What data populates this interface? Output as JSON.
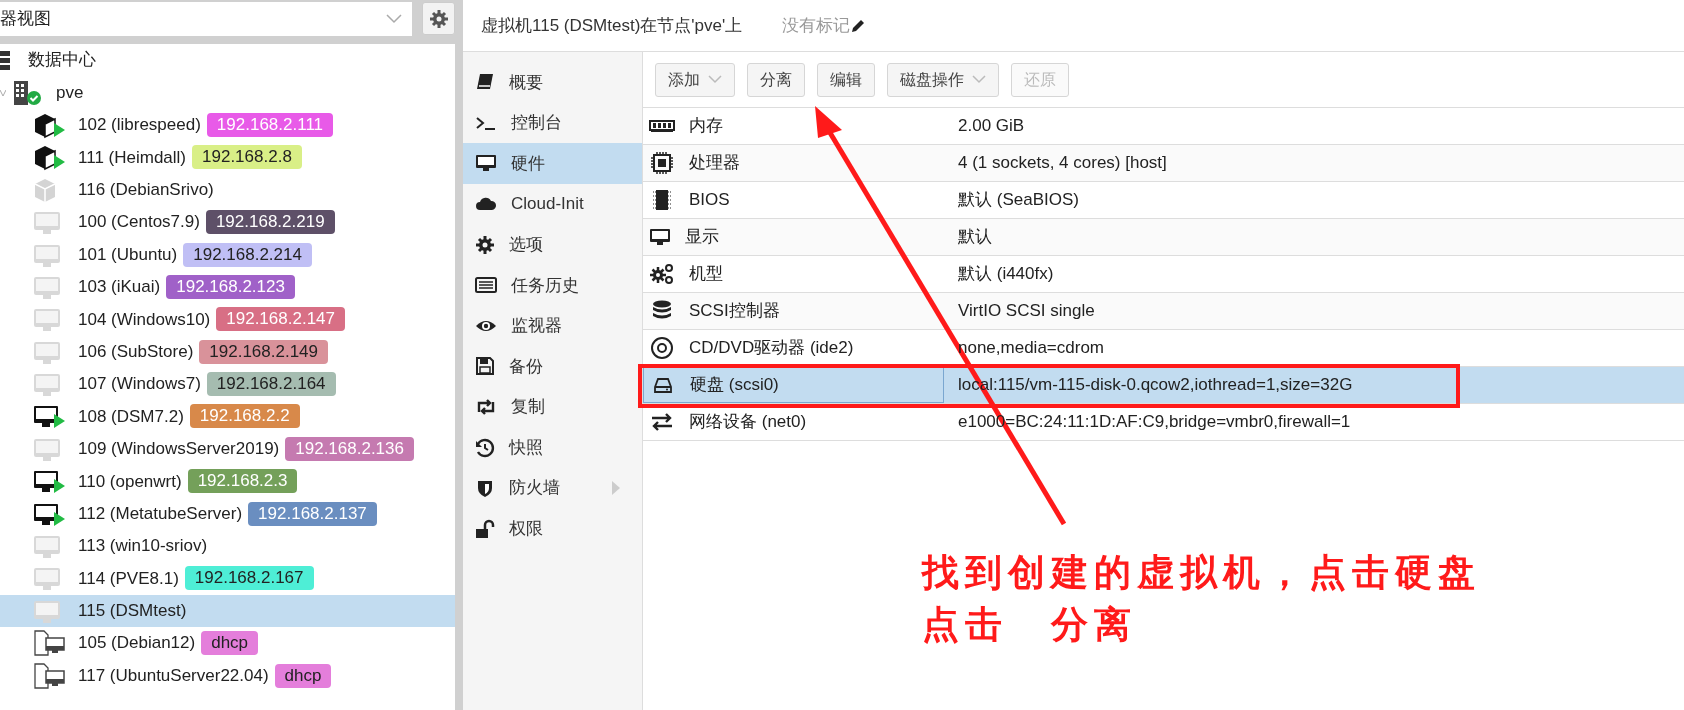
{
  "view_selector": {
    "value": "器视图"
  },
  "tree": [
    {
      "label": "数据中心",
      "kind": "datacenter",
      "selected": false,
      "children": [
        {
          "label": "pve",
          "kind": "node",
          "selected": false,
          "expanded": true,
          "children": [
            {
              "label": "102 (librespeed)",
              "kind": "ct-running",
              "selected": false,
              "tag": "192.168.2.111",
              "color": "#e85ae8"
            },
            {
              "label": "111 (Heimdall)",
              "kind": "ct-running",
              "selected": false,
              "tag": "192.168.2.8",
              "color": "#d9ef87"
            },
            {
              "label": "116 (DebianSrivo)",
              "kind": "ct-stopped",
              "selected": false
            },
            {
              "label": "100 (Centos7.9)",
              "kind": "vm-stopped",
              "selected": false,
              "tag": "192.168.2.219",
              "color": "#5e5068"
            },
            {
              "label": "101 (Ubuntu)",
              "kind": "vm-stopped",
              "selected": false,
              "tag": "192.168.2.214",
              "color": "#c0bff5"
            },
            {
              "label": "103 (iKuai)",
              "kind": "vm-stopped",
              "selected": false,
              "tag": "192.168.2.123",
              "color": "#a061c8"
            },
            {
              "label": "104 (Windows10)",
              "kind": "vm-stopped",
              "selected": false,
              "tag": "192.168.2.147",
              "color": "#d86f85"
            },
            {
              "label": "106 (SubStore)",
              "kind": "vm-stopped",
              "selected": false,
              "tag": "192.168.2.149",
              "color": "#d9929a"
            },
            {
              "label": "107 (Windows7)",
              "kind": "vm-stopped",
              "selected": false,
              "tag": "192.168.2.164",
              "color": "#a5bcb0"
            },
            {
              "label": "108 (DSM7.2)",
              "kind": "vm-running",
              "selected": false,
              "tag": "192.168.2.2",
              "color": "#d8894a"
            },
            {
              "label": "109 (WindowsServer2019)",
              "kind": "vm-stopped",
              "selected": false,
              "tag": "192.168.2.136",
              "color": "#c57ab0"
            },
            {
              "label": "110 (openwrt)",
              "kind": "vm-running",
              "selected": false,
              "tag": "192.168.2.3",
              "color": "#74a05a"
            },
            {
              "label": "112 (MetatubeServer)",
              "kind": "vm-running",
              "selected": false,
              "tag": "192.168.2.137",
              "color": "#6a8ec0"
            },
            {
              "label": "113 (win10-sriov)",
              "kind": "vm-stopped",
              "selected": false
            },
            {
              "label": "114 (PVE8.1)",
              "kind": "vm-stopped",
              "selected": false,
              "tag": "192.168.2.167",
              "color": "#4eeed6"
            },
            {
              "label": "115 (DSMtest)",
              "kind": "vm-stopped",
              "selected": true
            },
            {
              "label": "105 (Debian12)",
              "kind": "template",
              "selected": false,
              "tag": "dhcp",
              "color": "#e47edb"
            },
            {
              "label": "117 (UbuntuServer22.04)",
              "kind": "template",
              "selected": false,
              "tag": "dhcp",
              "color": "#e47edb"
            }
          ]
        }
      ]
    }
  ],
  "header": {
    "title": "虚拟机115 (DSMtest)在节点'pve'上",
    "tags": "没有标记"
  },
  "nav": [
    {
      "label": "概要",
      "kind": "book",
      "selected": false,
      "submenu": false
    },
    {
      "label": "控制台",
      "kind": "terminal",
      "selected": false,
      "submenu": false
    },
    {
      "label": "硬件",
      "kind": "desktop",
      "selected": true,
      "submenu": false
    },
    {
      "label": "Cloud-Init",
      "kind": "cloud",
      "selected": false,
      "submenu": false
    },
    {
      "label": "选项",
      "kind": "gear",
      "selected": false,
      "submenu": false
    },
    {
      "label": "任务历史",
      "kind": "list",
      "selected": false,
      "submenu": false
    },
    {
      "label": "监视器",
      "kind": "eye",
      "selected": false,
      "submenu": false
    },
    {
      "label": "备份",
      "kind": "floppy",
      "selected": false,
      "submenu": false
    },
    {
      "label": "复制",
      "kind": "retweet",
      "selected": false,
      "submenu": false
    },
    {
      "label": "快照",
      "kind": "history",
      "selected": false,
      "submenu": false
    },
    {
      "label": "防火墙",
      "kind": "shield",
      "selected": false,
      "submenu": true
    },
    {
      "label": "权限",
      "kind": "unlock",
      "selected": false,
      "submenu": false
    }
  ],
  "toolbar": [
    {
      "label": "添加",
      "dropdown": true,
      "disabled": false
    },
    {
      "label": "分离",
      "dropdown": false,
      "disabled": false
    },
    {
      "label": "编辑",
      "dropdown": false,
      "disabled": false
    },
    {
      "label": "磁盘操作",
      "dropdown": true,
      "disabled": false
    },
    {
      "label": "还原",
      "dropdown": false,
      "disabled": true
    }
  ],
  "hardware": [
    {
      "kind": "memory",
      "name": "内存",
      "value": "2.00 GiB",
      "selected": false
    },
    {
      "kind": "cpu",
      "name": "处理器",
      "value": "4 (1 sockets, 4 cores) [host]",
      "selected": false
    },
    {
      "kind": "chip",
      "name": "BIOS",
      "value": "默认 (SeaBIOS)",
      "selected": false
    },
    {
      "kind": "desktop",
      "name": "显示",
      "value": "默认",
      "selected": false
    },
    {
      "kind": "gears",
      "name": "机型",
      "value": "默认 (i440fx)",
      "selected": false
    },
    {
      "kind": "database",
      "name": "SCSI控制器",
      "value": "VirtIO SCSI single",
      "selected": false
    },
    {
      "kind": "disc",
      "name": "CD/DVD驱动器 (ide2)",
      "value": "none,media=cdrom",
      "selected": false
    },
    {
      "kind": "hdd",
      "name": "硬盘 (scsi0)",
      "value": "local:115/vm-115-disk-0.qcow2,iothread=1,size=32G",
      "selected": true
    },
    {
      "kind": "exchange",
      "name": "网络设备 (net0)",
      "value": "e1000=BC:24:11:1D:AF:C9,bridge=vmbr0,firewall=1",
      "selected": false
    }
  ],
  "annotation": {
    "lines": [
      "找到创建的虚拟机，点击硬盘",
      "点击　分离"
    ]
  }
}
